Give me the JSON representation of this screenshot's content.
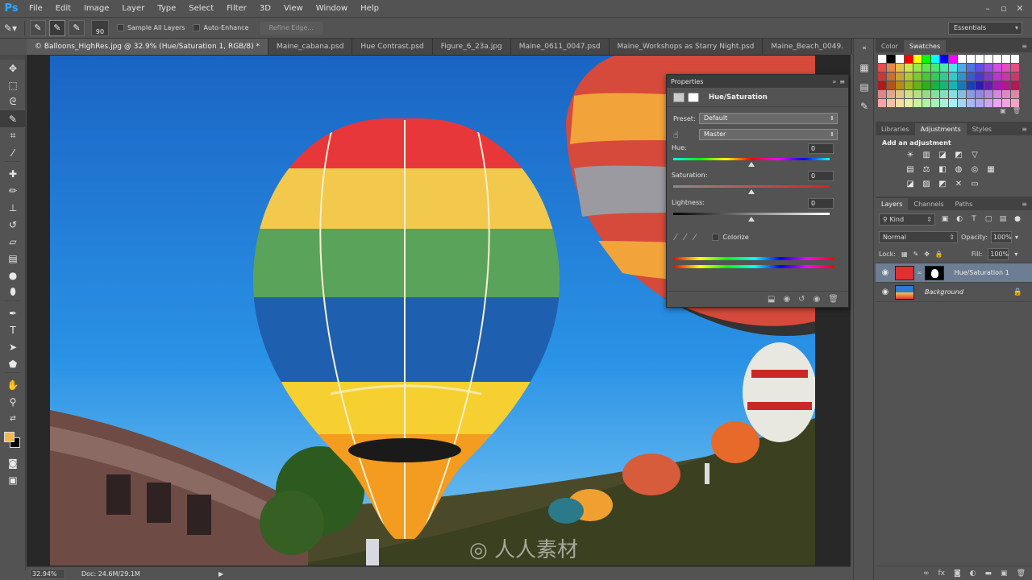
{
  "app": {
    "logo": "Ps"
  },
  "menu": [
    "File",
    "Edit",
    "Image",
    "Layer",
    "Type",
    "Select",
    "Filter",
    "3D",
    "View",
    "Window",
    "Help"
  ],
  "options": {
    "brush_size": "90",
    "sample_all_layers": "Sample All Layers",
    "auto_enhance": "Auto-Enhance",
    "refine_edge": "Refine Edge...",
    "workspace": "Essentials"
  },
  "tabs": [
    {
      "label": "© Balloons_HighRes.jpg @ 32.9% (Hue/Saturation 1, RGB/8) *",
      "active": true
    },
    {
      "label": "Maine_cabana.psd",
      "active": false
    },
    {
      "label": "Hue Contrast.psd",
      "active": false
    },
    {
      "label": "Figure_6_23a.jpg",
      "active": false
    },
    {
      "label": "Maine_0611_0047.psd",
      "active": false
    },
    {
      "label": "Maine_Workshops as Starry Night.psd",
      "active": false
    },
    {
      "label": "Maine_Beach_0049.",
      "active": false
    }
  ],
  "status": {
    "zoom": "32.94%",
    "doc": "Doc: 24.6M/29.1M"
  },
  "properties": {
    "panel_title": "Properties",
    "adjustment": "Hue/Saturation",
    "preset_label": "Preset:",
    "preset_value": "Default",
    "channel_value": "Master",
    "hue_label": "Hue:",
    "hue_value": "0",
    "saturation_label": "Saturation:",
    "saturation_value": "0",
    "lightness_label": "Lightness:",
    "lightness_value": "0",
    "colorize": "Colorize"
  },
  "right": {
    "color_tabs": [
      "Color",
      "Swatches"
    ],
    "adj_tabs": [
      "Libraries",
      "Adjustments",
      "Styles"
    ],
    "adj_title": "Add an adjustment",
    "layer_tabs": [
      "Layers",
      "Channels",
      "Paths"
    ],
    "kind": "Kind",
    "blend_mode": "Normal",
    "opacity_label": "Opacity:",
    "opacity": "100%",
    "lock_label": "Lock:",
    "fill_label": "Fill:",
    "fill": "100%",
    "layers": [
      {
        "name": "Hue/Saturation 1",
        "selected": true
      },
      {
        "name": "Background",
        "selected": false
      }
    ]
  },
  "colors": {
    "swatch_row1": [
      "#ffffff",
      "#000000",
      "#ffffff",
      "#ff0000",
      "#ffff00",
      "#00ff00",
      "#00ffff",
      "#0000ff",
      "#ff00ff",
      "#ffffff",
      "#ffffff",
      "#ffffff",
      "#ffffff",
      "#ffffff",
      "#ffffff",
      "#ffffff"
    ],
    "accent_fg": "#f2b84b",
    "selected_layer": "#6d7d93"
  }
}
